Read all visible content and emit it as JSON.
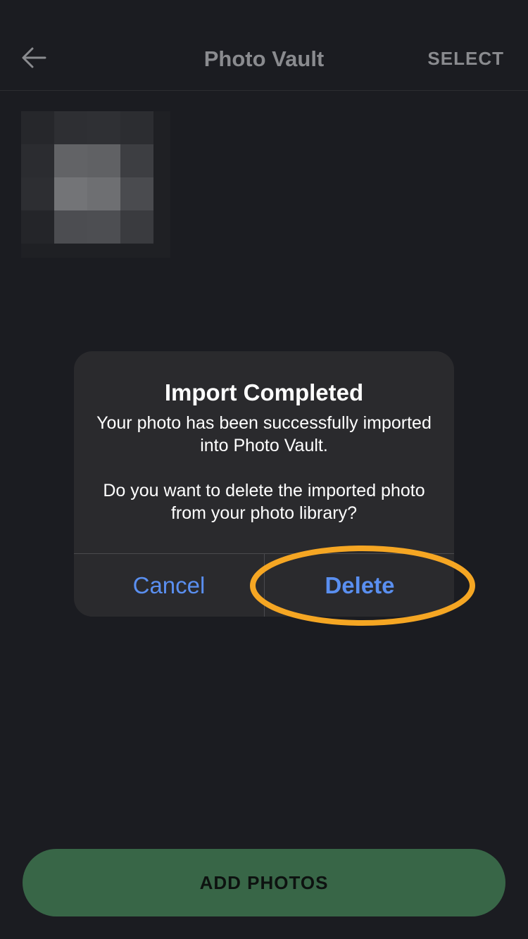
{
  "header": {
    "title": "Photo Vault",
    "select_label": "SELECT",
    "back_icon": "arrow-left-icon"
  },
  "thumbnail": {
    "pixel_colors": [
      [
        "#26272b",
        "#2e2f33",
        "#2f3034",
        "#2c2d31"
      ],
      [
        "#2b2c30",
        "#626366",
        "#606164",
        "#3d3e42"
      ],
      [
        "#2d2e32",
        "#737477",
        "#6e6f72",
        "#4a4b4f"
      ],
      [
        "#242529",
        "#4c4d51",
        "#4d4e52",
        "#3a3b3f"
      ]
    ]
  },
  "alert": {
    "title": "Import Completed",
    "message": "Your photo has been successfully imported into Photo Vault.\n\nDo you want to delete the imported photo from your photo library?",
    "cancel_label": "Cancel",
    "delete_label": "Delete"
  },
  "footer": {
    "add_photos_label": "ADD PHOTOS"
  },
  "colors": {
    "background": "#1b1c21",
    "alert_background": "#2a2a2d",
    "alert_button_text": "#5a8ff0",
    "add_photos_button": "#386647",
    "highlight_ring": "#f5a623",
    "header_text": "#8a8b8f"
  }
}
